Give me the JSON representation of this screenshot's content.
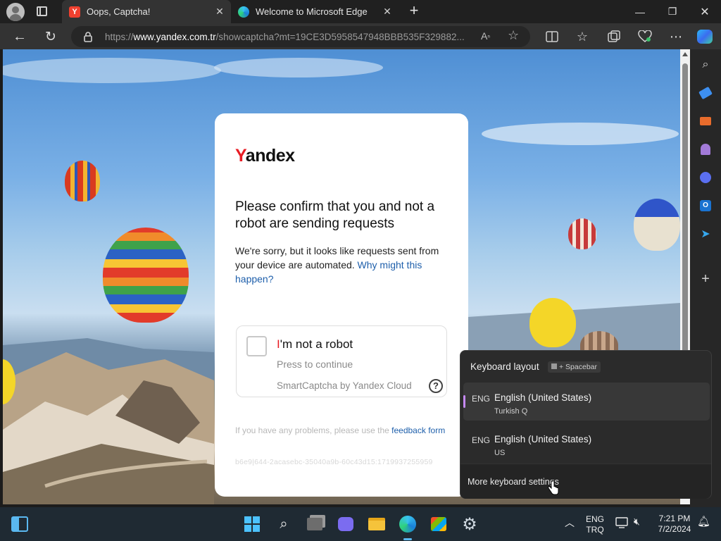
{
  "tabs": [
    {
      "title": "Oops, Captcha!",
      "favicon_letter": "Y",
      "active": true
    },
    {
      "title": "Welcome to Microsoft Edge",
      "active": false
    }
  ],
  "address_bar": {
    "url_prefix": "https://",
    "url_host": "www.yandex.com.tr",
    "url_path": "/showcaptcha?mt=19CE3D5958547948BBB535F329882..."
  },
  "captcha": {
    "logo_first": "Y",
    "logo_rest": "andex",
    "heading": "Please confirm that you and not a robot are sending requests",
    "description": "We're sorry, but it looks like requests sent from your device are automated.",
    "why_link": "Why might this happen?",
    "robot_first": "I",
    "robot_rest": "'m not a robot",
    "press_continue": "Press to continue",
    "smartcaptcha": "SmartCaptcha by Yandex Cloud",
    "help_glyph": "?",
    "feedback_text": "If you have any problems, please use the",
    "feedback_link": "feedback form",
    "hash": "b6e9|644-2acasebc-35040a9b-60c43d15:1719937255959"
  },
  "keyboard_flyout": {
    "header": "Keyboard layout",
    "shortcut": "+ Spacebar",
    "layouts": [
      {
        "code": "ENG",
        "name": "English (United States)",
        "sub": "Turkish Q",
        "selected": true
      },
      {
        "code": "ENG",
        "name": "English (United States)",
        "sub": "US",
        "selected": false
      }
    ],
    "more": "More keyboard settings"
  },
  "tray": {
    "lang_line1": "ENG",
    "lang_line2": "TRQ",
    "time": "7:21 PM",
    "date": "7/2/2024"
  },
  "colors": {
    "accent_red": "#e81c24",
    "link_blue": "#1e5fab",
    "edge_chrome": "#333333"
  }
}
